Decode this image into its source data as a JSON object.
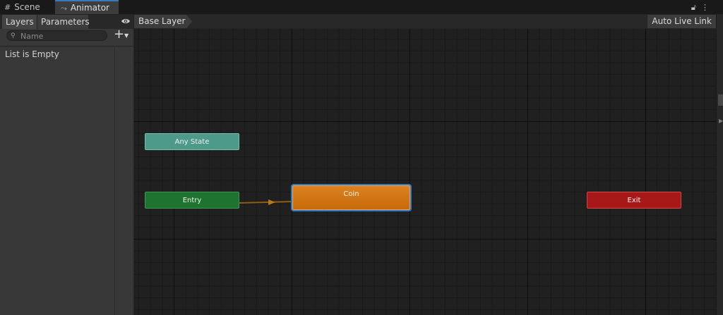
{
  "tabs": [
    {
      "label": "Scene",
      "icon": "grid-icon"
    },
    {
      "label": "Animator",
      "icon": "animator-icon"
    }
  ],
  "panel": {
    "tabs": [
      "Layers",
      "Parameters"
    ],
    "search_placeholder": "Name",
    "empty_text": "List is Empty"
  },
  "breadcrumb": "Base Layer",
  "live_link": "Auto Live Link",
  "graph": {
    "nodes": {
      "any_state": "Any State",
      "entry": "Entry",
      "coin": "Coin",
      "exit": "Exit"
    }
  },
  "colors": {
    "selection": "#2d7bc4",
    "default_state": "#d47512",
    "entry": "#1e7330",
    "exit": "#a81818",
    "any_state": "#4d9a8b",
    "transition": "#8c5e13"
  }
}
